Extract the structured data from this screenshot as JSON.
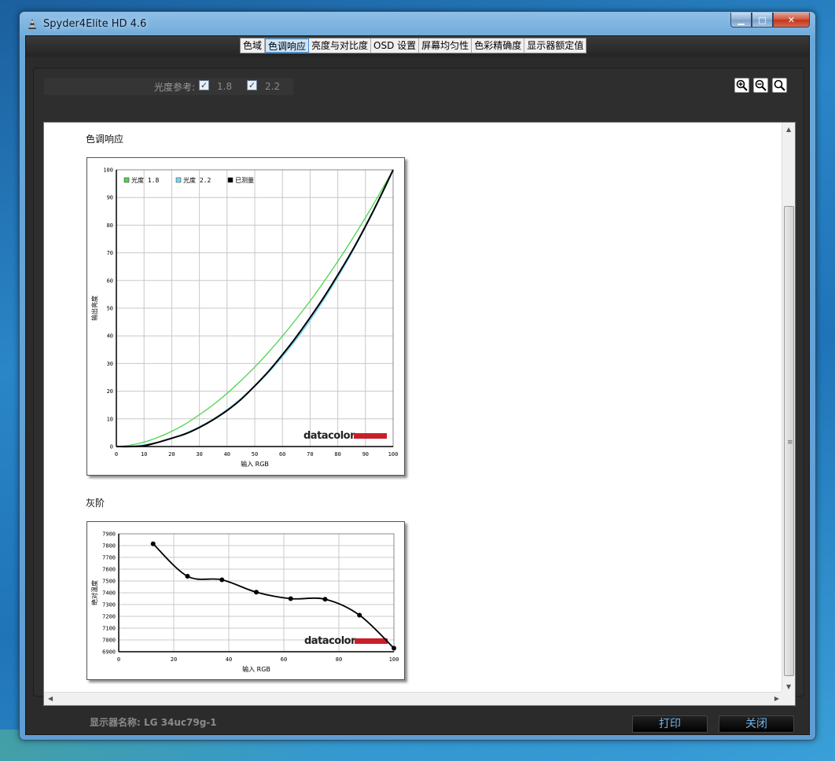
{
  "window": {
    "title": "Spyder4Elite HD 4.6"
  },
  "tabs": [
    {
      "label": "色域"
    },
    {
      "label": "色调响应"
    },
    {
      "label": "亮度与对比度"
    },
    {
      "label": "OSD 设置"
    },
    {
      "label": "屏幕均匀性"
    },
    {
      "label": "色彩精确度"
    },
    {
      "label": "显示器额定值"
    }
  ],
  "active_tab": "色调响应",
  "gamma_ref": {
    "label": "光度参考:",
    "options": [
      {
        "value": "1.8",
        "checked": true
      },
      {
        "value": "2.2",
        "checked": true
      }
    ]
  },
  "sections": {
    "tone": "色调响应",
    "gray": "灰阶"
  },
  "footer": {
    "display_name": "显示器名称: LG 34uc79g-1",
    "print_label": "打印",
    "close_label": "关闭"
  },
  "colors": {
    "gamma18": "#4fd34f",
    "gamma22": "#79d6f0",
    "measured": "#000000",
    "brand_red": "#c8202a"
  },
  "chart_data": [
    {
      "type": "line",
      "xlabel": "输入 RGB",
      "ylabel": "输出亮度",
      "xlim": [
        0,
        100
      ],
      "ylim": [
        0,
        100
      ],
      "xticks": [
        0,
        10,
        20,
        30,
        40,
        50,
        60,
        70,
        80,
        90,
        100
      ],
      "yticks": [
        0,
        10,
        20,
        30,
        40,
        50,
        60,
        70,
        80,
        90,
        100
      ],
      "grid": true,
      "legend_position": "top-left",
      "logo": "datacolor",
      "series": [
        {
          "name": "光度 1.8",
          "color": "#4fd34f",
          "x": [
            0,
            5,
            10,
            15,
            20,
            25,
            30,
            35,
            40,
            45,
            50,
            55,
            60,
            65,
            70,
            75,
            80,
            85,
            90,
            95,
            100
          ],
          "y": [
            0,
            0.5,
            1.6,
            3.3,
            5.5,
            8.2,
            11.5,
            15.1,
            19.2,
            23.8,
            28.7,
            34.1,
            39.9,
            46.1,
            52.6,
            59.6,
            66.9,
            74.6,
            82.7,
            91.2,
            100
          ]
        },
        {
          "name": "光度 2.2",
          "color": "#79d6f0",
          "x": [
            0,
            5,
            10,
            15,
            20,
            25,
            30,
            35,
            40,
            45,
            50,
            55,
            60,
            65,
            70,
            75,
            80,
            85,
            90,
            95,
            100
          ],
          "y": [
            0,
            0.1,
            0.6,
            1.5,
            2.9,
            4.8,
            7.1,
            9.9,
            13.3,
            17.3,
            21.8,
            26.8,
            32.5,
            38.7,
            45.6,
            53.1,
            61.2,
            69.9,
            79.3,
            89.3,
            100
          ]
        },
        {
          "name": "已测量",
          "color": "#000000",
          "x": [
            0,
            5,
            10,
            15,
            20,
            25,
            30,
            35,
            40,
            45,
            50,
            55,
            60,
            65,
            70,
            75,
            80,
            85,
            90,
            95,
            100
          ],
          "y": [
            0,
            0,
            0.3,
            1.5,
            3,
            4.6,
            6.9,
            9.7,
            13,
            17,
            21.9,
            27.2,
            33.2,
            39.6,
            46.6,
            54,
            62,
            70.4,
            79.6,
            89.5,
            100
          ]
        }
      ]
    },
    {
      "type": "line",
      "xlabel": "输入 RGB",
      "ylabel": "绝对温度",
      "xlim": [
        0,
        100
      ],
      "ylim": [
        6900,
        7900
      ],
      "xticks": [
        0,
        20,
        40,
        60,
        80,
        100
      ],
      "yticks": [
        6900,
        7000,
        7100,
        7200,
        7300,
        7400,
        7500,
        7600,
        7700,
        7800,
        7900
      ],
      "grid": true,
      "logo": "datacolor",
      "series": [
        {
          "color": "#000000",
          "x": [
            12.5,
            25,
            37.5,
            50,
            62.5,
            75,
            87.5,
            100
          ],
          "y": [
            7815,
            7540,
            7510,
            7405,
            7350,
            7345,
            7210,
            6930
          ]
        }
      ]
    }
  ]
}
